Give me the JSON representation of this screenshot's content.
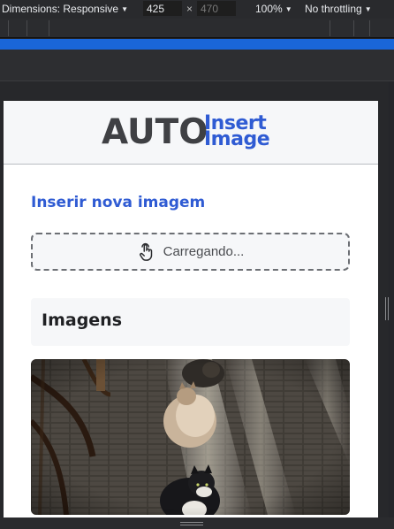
{
  "devtools": {
    "dimensions_label": "Dimensions: Responsive",
    "width_value": "425",
    "height_value": "470",
    "times": "×",
    "zoom_label": "100%",
    "throttle_label": "No throttling"
  },
  "app": {
    "logo_auto": "AUTO",
    "logo_insert": "Insert",
    "logo_image": "Image",
    "section_title": "Inserir nova imagem",
    "dropzone_label": "Carregando...",
    "images_title": "Imagens"
  },
  "icons": {
    "dropzone_icon": "pointing-hand-icon",
    "caret": "caret-down-icon"
  },
  "colors": {
    "brand_blue": "#2f5bd3",
    "logo_dark": "#3f4044",
    "devtools_accent": "#1a66d8"
  }
}
